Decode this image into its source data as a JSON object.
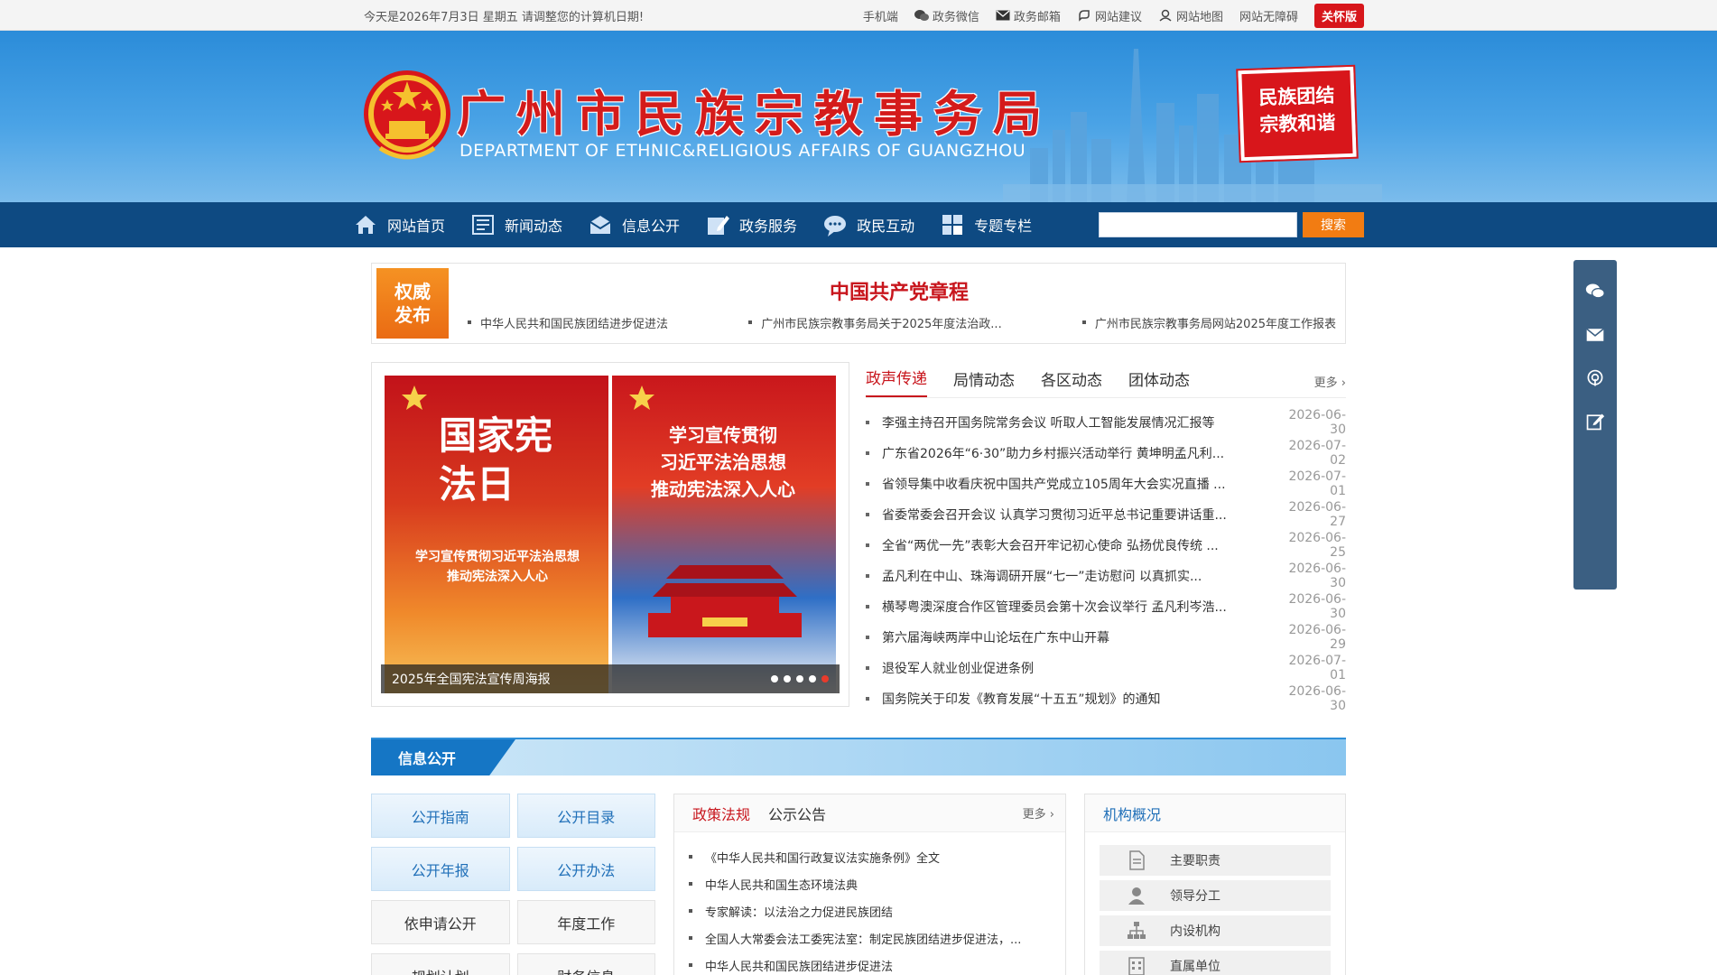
{
  "topbar": {
    "date_text": "今天是2026年7月3日 星期五 请调整您的计算机日期!",
    "links": [
      {
        "label": "手机端",
        "icon": "none"
      },
      {
        "label": "政务微信",
        "icon": "wechat-icon"
      },
      {
        "label": "政务邮箱",
        "icon": "mail-icon"
      },
      {
        "label": "网站建议",
        "icon": "suggestion-icon"
      },
      {
        "label": "网站地图",
        "icon": "map-pin-icon"
      },
      {
        "label": "网站无障碍",
        "icon": "none"
      }
    ],
    "care_label": "关怀版"
  },
  "banner": {
    "title": "广州市民族宗教事务局",
    "subtitle": "DEPARTMENT OF ETHNIC&RELIGIOUS AFFAIRS OF GUANGZHOU",
    "seal_line1": "民族团结",
    "seal_line2": "宗教和谐"
  },
  "nav": {
    "items": [
      "网站首页",
      "新闻动态",
      "信息公开",
      "政务服务",
      "政民互动",
      "专题专栏"
    ],
    "search_placeholder": "",
    "search_label": "搜索"
  },
  "authority": {
    "badge_line1": "权威",
    "badge_line2": "发布",
    "title": "中国共产党章程",
    "links": [
      "中华人民共和国民族团结进步促进法",
      "广州市民族宗教事务局关于2025年度法治政...",
      "广州市民族宗教事务局网站2025年度工作报表"
    ]
  },
  "carousel": {
    "caption": "2025年全国宪法宣传周海报",
    "poster1_title": "国家宪法日",
    "poster1_sub1": "学习宣传贯彻习近平法治思想",
    "poster1_sub2": "推动宪法深入人心",
    "poster2_line1": "学习宣传贯彻",
    "poster2_line2": "习近平法治思想",
    "poster2_line3": "推动宪法深入人心",
    "dot_count": 5,
    "active_dot": 5
  },
  "news": {
    "tabs": [
      "政声传递",
      "局情动态",
      "各区动态",
      "团体动态"
    ],
    "active_tab": 0,
    "more_label": "更多 ›",
    "items": [
      {
        "title": "李强主持召开国务院常务会议 听取人工智能发展情况汇报等",
        "date": "2026-06-30"
      },
      {
        "title": "广东省2026年“6·30”助力乡村振兴活动举行 黄坤明孟凡利...",
        "date": "2026-07-02"
      },
      {
        "title": "省领导集中收看庆祝中国共产党成立105周年大会实况直播 ...",
        "date": "2026-07-01"
      },
      {
        "title": "省委常委会召开会议 认真学习贯彻习近平总书记重要讲话重...",
        "date": "2026-06-27"
      },
      {
        "title": "全省“两优一先”表彰大会召开牢记初心使命 弘扬优良传统 ...",
        "date": "2026-06-25"
      },
      {
        "title": "孟凡利在中山、珠海调研开展“七一”走访慰问 以真抓实...",
        "date": "2026-06-30"
      },
      {
        "title": "横琴粤澳深度合作区管理委员会第十次会议举行 孟凡利岑浩...",
        "date": "2026-06-30"
      },
      {
        "title": "第六届海峡两岸中山论坛在广东中山开幕",
        "date": "2026-06-29"
      },
      {
        "title": "退役军人就业创业促进条例",
        "date": "2026-07-01"
      },
      {
        "title": "国务院关于印发《教育发展“十五五”规划》的通知",
        "date": "2026-06-30"
      }
    ]
  },
  "info": {
    "section_title": "信息公开",
    "guide_buttons": [
      {
        "label": "公开指南",
        "style": "blue"
      },
      {
        "label": "公开目录",
        "style": "blue"
      },
      {
        "label": "公开年报",
        "style": "blue"
      },
      {
        "label": "公开办法",
        "style": "blue"
      },
      {
        "label": "依申请公开",
        "style": "plain"
      },
      {
        "label": "年度工作",
        "style": "plain"
      },
      {
        "label": "规划计划",
        "style": "plain"
      },
      {
        "label": "财务信息",
        "style": "plain"
      }
    ],
    "policy_tabs": [
      "政策法规",
      "公示公告"
    ],
    "policy_more": "更多 ›",
    "policy_items": [
      "《中华人民共和国行政复议法实施条例》全文",
      "中华人民共和国生态环境法典",
      "专家解读：以法治之力促进民族团结",
      "全国人大常委会法工委宪法室：制定民族团结进步促进法，...",
      "中华人民共和国民族团结进步促进法"
    ],
    "org_title": "机构概况",
    "org_items": [
      {
        "label": "主要职责",
        "icon": "document-icon"
      },
      {
        "label": "领导分工",
        "icon": "person-icon"
      },
      {
        "label": "内设机构",
        "icon": "org-chart-icon"
      },
      {
        "label": "直属单位",
        "icon": "building-icon"
      }
    ]
  },
  "colors": {
    "nav_bg": "#0e4a82",
    "accent_red": "#c8161d",
    "accent_orange": "#f27c12",
    "banner_blue": "#2b8cd9",
    "side_float": "#3b5f82"
  },
  "sidefloat": [
    "wechat-icon",
    "mail-icon",
    "podcast-icon",
    "edit-icon"
  ]
}
